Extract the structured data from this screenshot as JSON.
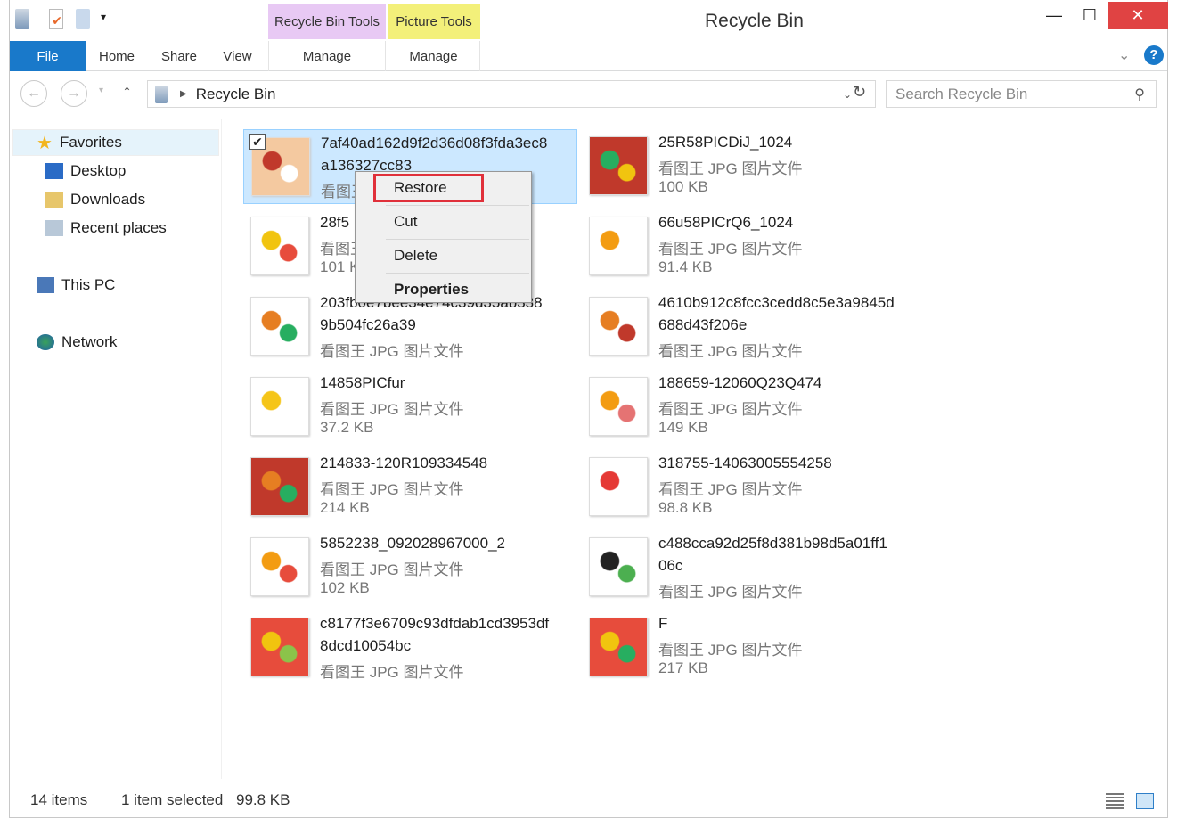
{
  "window": {
    "title": "Recycle Bin",
    "minimize": "—",
    "maximize": "☐",
    "close": "✕"
  },
  "ribbon": {
    "contextual": [
      {
        "label": "Recycle Bin Tools",
        "color": "#e8c9f4"
      },
      {
        "label": "Picture Tools",
        "color": "#f3f07a"
      }
    ],
    "tabs": [
      "File",
      "Home",
      "Share",
      "View",
      "Manage",
      "Manage"
    ]
  },
  "address": {
    "path": "Recycle Bin",
    "search_placeholder": "Search Recycle Bin"
  },
  "sidebar": {
    "favorites": "Favorites",
    "items": [
      "Desktop",
      "Downloads",
      "Recent places"
    ],
    "this_pc": "This PC",
    "network": "Network"
  },
  "files": {
    "left": [
      {
        "lines": [
          "7af40ad162d9f2d36d08f3fda3ec8",
          "a136327cc83",
          "看图王 JPG 图片文件"
        ],
        "selected": true,
        "colors": [
          "#f4c9a0",
          "#c0392b",
          "#fff"
        ]
      },
      {
        "lines": [
          "28f5",
          "看图王 JPG 图片文件",
          "101 KB"
        ],
        "colors": [
          "#fff",
          "#f1c40f",
          "#e74c3c"
        ]
      },
      {
        "lines": [
          "203fb0e7bee34e74c39d35ab338",
          "9b504fc26a39",
          "看图王 JPG 图片文件"
        ],
        "colors": [
          "#fff",
          "#e67e22",
          "#27ae60"
        ]
      },
      {
        "lines": [
          "14858PICfur",
          "看图王 JPG 图片文件",
          "37.2 KB"
        ],
        "colors": [
          "#fff",
          "#f5c518",
          "#fff"
        ]
      },
      {
        "lines": [
          "214833-120R109334548",
          "看图王 JPG 图片文件",
          "214 KB"
        ],
        "colors": [
          "#c0392b",
          "#e67e22",
          "#27ae60"
        ]
      },
      {
        "lines": [
          "5852238_092028967000_2",
          "看图王 JPG 图片文件",
          "102 KB"
        ],
        "colors": [
          "#fff",
          "#f39c12",
          "#e74c3c"
        ]
      },
      {
        "lines": [
          "c8177f3e6709c93dfdab1cd3953df",
          "8dcd10054bc",
          "看图王 JPG 图片文件"
        ],
        "colors": [
          "#e74c3c",
          "#f1c40f",
          "#8bc34a"
        ]
      }
    ],
    "right": [
      {
        "lines": [
          "25R58PICDiJ_1024",
          "看图王 JPG 图片文件",
          "100 KB"
        ],
        "colors": [
          "#c0392b",
          "#27ae60",
          "#f1c40f"
        ]
      },
      {
        "lines": [
          "66u58PICrQ6_1024",
          "看图王 JPG 图片文件",
          "91.4 KB"
        ],
        "colors": [
          "#fff",
          "#f39c12",
          "#fff"
        ]
      },
      {
        "lines": [
          "4610b912c8fcc3cedd8c5e3a9845d",
          "688d43f206e",
          "看图王 JPG 图片文件"
        ],
        "colors": [
          "#fff",
          "#e67e22",
          "#c0392b"
        ]
      },
      {
        "lines": [
          "188659-12060Q23Q474",
          "看图王 JPG 图片文件",
          "149 KB"
        ],
        "colors": [
          "#fff",
          "#f39c12",
          "#e57373"
        ]
      },
      {
        "lines": [
          "318755-14063005554258",
          "看图王 JPG 图片文件",
          "98.8 KB"
        ],
        "colors": [
          "#fff",
          "#e53935",
          "#fff"
        ]
      },
      {
        "lines": [
          "c488cca92d25f8d381b98d5a01ff1",
          "06c",
          "看图王 JPG 图片文件"
        ],
        "colors": [
          "#fff",
          "#222",
          "#4caf50"
        ]
      },
      {
        "lines": [
          "F",
          "看图王 JPG 图片文件",
          "217 KB"
        ],
        "colors": [
          "#e74c3c",
          "#f1c40f",
          "#27ae60"
        ]
      }
    ]
  },
  "context_menu": {
    "items": [
      "Restore",
      "Cut",
      "Delete",
      "Properties"
    ],
    "highlight_color": "#e0303a"
  },
  "status": {
    "count": "14 items",
    "selected": "1 item selected",
    "size": "99.8 KB"
  }
}
